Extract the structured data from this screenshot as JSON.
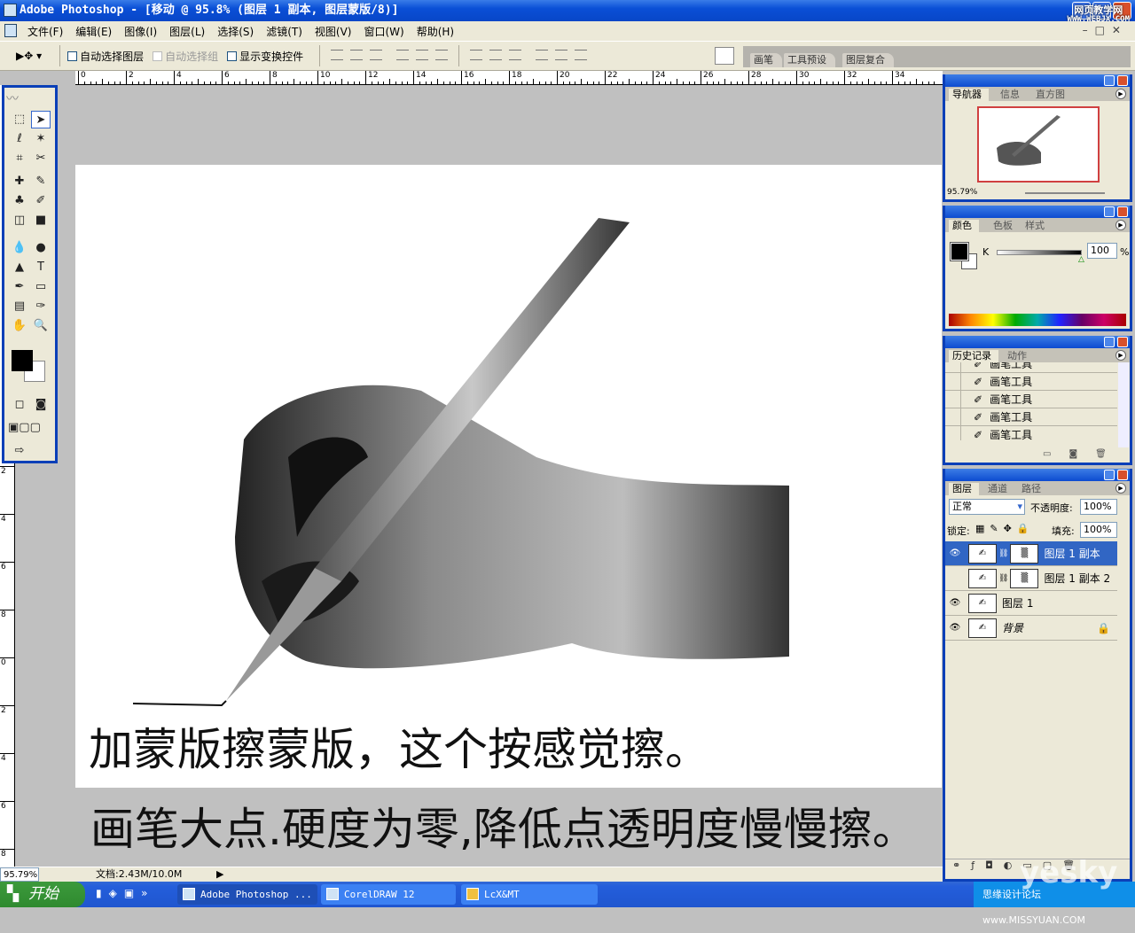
{
  "window": {
    "title": "Adobe Photoshop - [移动 @ 95.8% (图层 1 副本, 图层蒙版/8)]",
    "watermark_line1": "网页教学网",
    "watermark_line2": "WWW.WEBJX.COM"
  },
  "menu": [
    "文件(F)",
    "编辑(E)",
    "图像(I)",
    "图层(L)",
    "选择(S)",
    "滤镜(T)",
    "视图(V)",
    "窗口(W)",
    "帮助(H)"
  ],
  "options": {
    "auto_select_layer": "自动选择图层",
    "auto_select_group": "自动选择组",
    "show_transform": "显示变换控件"
  },
  "palette_well": [
    "画笔",
    "工具预设",
    "图层复合"
  ],
  "ruler": {
    "labels": [
      "0",
      "2",
      "4",
      "6",
      "8",
      "10",
      "12",
      "14",
      "16",
      "18",
      "20",
      "22",
      "24",
      "26",
      "28",
      "30",
      "32",
      "34"
    ],
    "vlabels": [
      "2",
      "4",
      "6",
      "8",
      "0",
      "2",
      "4",
      "6",
      "8"
    ]
  },
  "canvas": {
    "caption1": "加蒙版擦蒙版，这个按感觉擦。",
    "caption2": "画笔大点.硬度为零,降低点透明度慢慢擦。"
  },
  "navigator": {
    "tabs": [
      "导航器",
      "信息",
      "直方图"
    ],
    "zoom": "95.79%",
    "frame_color": "#d04040"
  },
  "color": {
    "tabs": [
      "颜色",
      "色板",
      "样式"
    ],
    "channel": "K",
    "value": "100",
    "unit": "%",
    "fg": "#000000",
    "bg": "#ffffff"
  },
  "history": {
    "tabs": [
      "历史记录",
      "动作"
    ],
    "items": [
      "画笔工具",
      "画笔工具",
      "画笔工具",
      "画笔工具",
      "画笔工具"
    ]
  },
  "layers": {
    "tabs": [
      "图层",
      "通道",
      "路径"
    ],
    "blend": "正常",
    "opacity_label": "不透明度:",
    "opacity": "100%",
    "lock_label": "锁定:",
    "fill_label": "填充:",
    "fill": "100%",
    "items": [
      {
        "name": "图层 1 副本",
        "visible": true,
        "selected": true,
        "mask": true
      },
      {
        "name": "图层 1 副本 2",
        "visible": false,
        "selected": false,
        "mask": true
      },
      {
        "name": "图层 1",
        "visible": true,
        "selected": false,
        "mask": false
      },
      {
        "name": "背景",
        "visible": true,
        "selected": false,
        "mask": false,
        "locked": true
      }
    ]
  },
  "status": {
    "zoom": "95.79%",
    "doc": "文档:2.43M/10.0M"
  },
  "taskbar": {
    "start": "开始",
    "tasks": [
      "Adobe Photoshop ...",
      "CorelDRAW 12",
      "LcX&MT"
    ],
    "tray_text": "思缘设计论坛 www.MISSYUAN.COM",
    "tray_logo": "yesky"
  }
}
